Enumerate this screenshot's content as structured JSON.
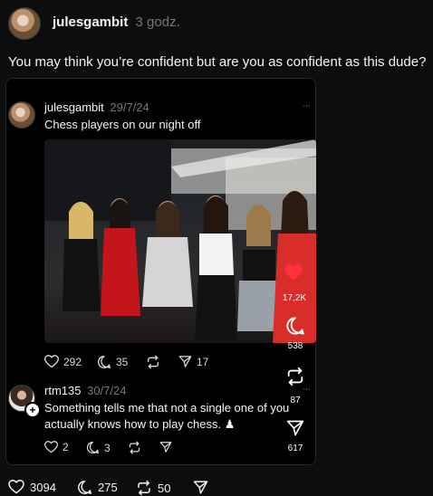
{
  "post": {
    "username": "julesgambit",
    "time": "3 godz.",
    "text": "You may think you’re confident but are you as confident as this dude?",
    "stats": {
      "likes": "3094",
      "replies": "275",
      "reposts": "50"
    }
  },
  "quoted": {
    "username": "julesgambit",
    "date": "29/7/24",
    "text": "Chess players on our night off",
    "more": "···",
    "stats": {
      "likes": "292",
      "replies": "35",
      "shares": "17"
    },
    "overlay": {
      "likes": "17,2K",
      "replies": "538",
      "reposts": "87",
      "shares": "617"
    }
  },
  "reply": {
    "username": "rtm135",
    "date": "30/7/24",
    "text_line1": "Something tells me that not a single one of you",
    "text_line2": "actually knows how to play chess. ♟",
    "more": "···",
    "stats": {
      "likes": "2",
      "replies": "3"
    }
  }
}
